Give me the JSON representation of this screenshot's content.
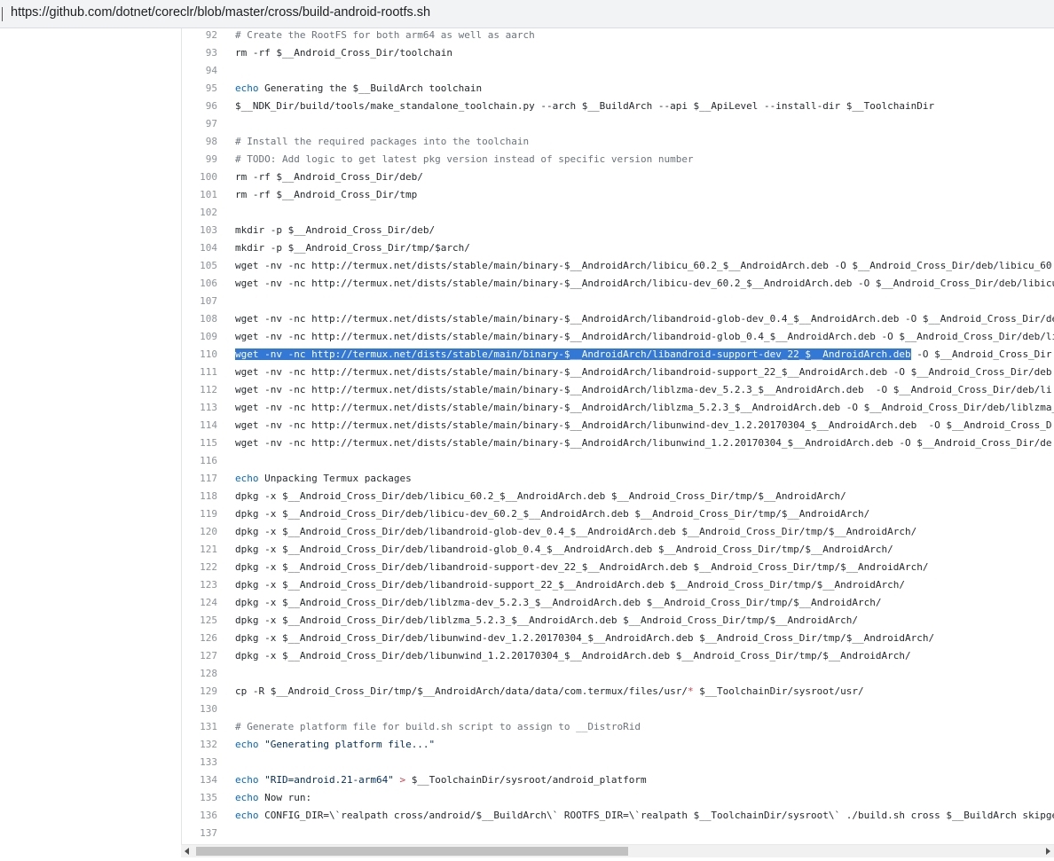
{
  "address_bar": {
    "url": "https://github.com/dotnet/coreclr/blob/master/cross/build-android-rootfs.sh"
  },
  "colors": {
    "keyword": "#0366d6",
    "comment": "#6a737d",
    "selection": "#3478d6"
  },
  "code": {
    "lines": [
      {
        "n": "92",
        "seg": [
          {
            "t": "# Create the RootFS for both arm64 as well as aarch",
            "c": "cm"
          }
        ]
      },
      {
        "n": "93",
        "seg": [
          {
            "t": "rm -rf $__Android_Cross_Dir/toolchain"
          }
        ]
      },
      {
        "n": "94",
        "seg": []
      },
      {
        "n": "95",
        "seg": [
          {
            "t": "echo",
            "c": "kw"
          },
          {
            "t": " Generating the $__BuildArch toolchain"
          }
        ]
      },
      {
        "n": "96",
        "seg": [
          {
            "t": "$__NDK_Dir/build/tools/make_standalone_toolchain.py --arch $__BuildArch --api $__ApiLevel --install-dir $__ToolchainDir"
          }
        ]
      },
      {
        "n": "97",
        "seg": []
      },
      {
        "n": "98",
        "seg": [
          {
            "t": "# Install the required packages into the toolchain",
            "c": "cm"
          }
        ]
      },
      {
        "n": "99",
        "seg": [
          {
            "t": "# TODO: Add logic to get latest pkg version instead of specific version number",
            "c": "cm"
          }
        ]
      },
      {
        "n": "100",
        "seg": [
          {
            "t": "rm -rf $__Android_Cross_Dir/deb/"
          }
        ]
      },
      {
        "n": "101",
        "seg": [
          {
            "t": "rm -rf $__Android_Cross_Dir/tmp"
          }
        ]
      },
      {
        "n": "102",
        "seg": []
      },
      {
        "n": "103",
        "seg": [
          {
            "t": "mkdir -p $__Android_Cross_Dir/deb/"
          }
        ]
      },
      {
        "n": "104",
        "seg": [
          {
            "t": "mkdir -p $__Android_Cross_Dir/tmp/$arch/"
          }
        ]
      },
      {
        "n": "105",
        "seg": [
          {
            "t": "wget -nv -nc http://termux.net/dists/stable/main/binary-$__AndroidArch/libicu_60.2_$__AndroidArch.deb -O $__Android_Cross_Dir/deb/libicu_60"
          }
        ]
      },
      {
        "n": "106",
        "seg": [
          {
            "t": "wget -nv -nc http://termux.net/dists/stable/main/binary-$__AndroidArch/libicu-dev_60.2_$__AndroidArch.deb -O $__Android_Cross_Dir/deb/libicu"
          }
        ]
      },
      {
        "n": "107",
        "seg": []
      },
      {
        "n": "108",
        "seg": [
          {
            "t": "wget -nv -nc http://termux.net/dists/stable/main/binary-$__AndroidArch/libandroid-glob-dev_0.4_$__AndroidArch.deb -O $__Android_Cross_Dir/de"
          }
        ]
      },
      {
        "n": "109",
        "seg": [
          {
            "t": "wget -nv -nc http://termux.net/dists/stable/main/binary-$__AndroidArch/libandroid-glob_0.4_$__AndroidArch.deb -O $__Android_Cross_Dir/deb/li"
          }
        ]
      },
      {
        "n": "110",
        "seg": [
          {
            "t": "wget -nv -nc http://termux.net/dists/stable/main/binary-$__AndroidArch/libandroid-support-dev_22_$__AndroidArch.deb",
            "c": "sel"
          },
          {
            "t": " -O $__Android_Cross_Dir"
          }
        ]
      },
      {
        "n": "111",
        "seg": [
          {
            "t": "wget -nv -nc http://termux.net/dists/stable/main/binary-$__AndroidArch/libandroid-support_22_$__AndroidArch.deb -O $__Android_Cross_Dir/deb"
          }
        ]
      },
      {
        "n": "112",
        "seg": [
          {
            "t": "wget -nv -nc http://termux.net/dists/stable/main/binary-$__AndroidArch/liblzma-dev_5.2.3_$__AndroidArch.deb  -O $__Android_Cross_Dir/deb/li"
          }
        ]
      },
      {
        "n": "113",
        "seg": [
          {
            "t": "wget -nv -nc http://termux.net/dists/stable/main/binary-$__AndroidArch/liblzma_5.2.3_$__AndroidArch.deb -O $__Android_Cross_Dir/deb/liblzma_"
          }
        ]
      },
      {
        "n": "114",
        "seg": [
          {
            "t": "wget -nv -nc http://termux.net/dists/stable/main/binary-$__AndroidArch/libunwind-dev_1.2.20170304_$__AndroidArch.deb  -O $__Android_Cross_D"
          }
        ]
      },
      {
        "n": "115",
        "seg": [
          {
            "t": "wget -nv -nc http://termux.net/dists/stable/main/binary-$__AndroidArch/libunwind_1.2.20170304_$__AndroidArch.deb -O $__Android_Cross_Dir/de"
          }
        ]
      },
      {
        "n": "116",
        "seg": []
      },
      {
        "n": "117",
        "seg": [
          {
            "t": "echo",
            "c": "kw"
          },
          {
            "t": " Unpacking Termux packages"
          }
        ]
      },
      {
        "n": "118",
        "seg": [
          {
            "t": "dpkg -x $__Android_Cross_Dir/deb/libicu_60.2_$__AndroidArch.deb $__Android_Cross_Dir/tmp/$__AndroidArch/"
          }
        ]
      },
      {
        "n": "119",
        "seg": [
          {
            "t": "dpkg -x $__Android_Cross_Dir/deb/libicu-dev_60.2_$__AndroidArch.deb $__Android_Cross_Dir/tmp/$__AndroidArch/"
          }
        ]
      },
      {
        "n": "120",
        "seg": [
          {
            "t": "dpkg -x $__Android_Cross_Dir/deb/libandroid-glob-dev_0.4_$__AndroidArch.deb $__Android_Cross_Dir/tmp/$__AndroidArch/"
          }
        ]
      },
      {
        "n": "121",
        "seg": [
          {
            "t": "dpkg -x $__Android_Cross_Dir/deb/libandroid-glob_0.4_$__AndroidArch.deb $__Android_Cross_Dir/tmp/$__AndroidArch/"
          }
        ]
      },
      {
        "n": "122",
        "seg": [
          {
            "t": "dpkg -x $__Android_Cross_Dir/deb/libandroid-support-dev_22_$__AndroidArch.deb $__Android_Cross_Dir/tmp/$__AndroidArch/"
          }
        ]
      },
      {
        "n": "123",
        "seg": [
          {
            "t": "dpkg -x $__Android_Cross_Dir/deb/libandroid-support_22_$__AndroidArch.deb $__Android_Cross_Dir/tmp/$__AndroidArch/"
          }
        ]
      },
      {
        "n": "124",
        "seg": [
          {
            "t": "dpkg -x $__Android_Cross_Dir/deb/liblzma-dev_5.2.3_$__AndroidArch.deb $__Android_Cross_Dir/tmp/$__AndroidArch/"
          }
        ]
      },
      {
        "n": "125",
        "seg": [
          {
            "t": "dpkg -x $__Android_Cross_Dir/deb/liblzma_5.2.3_$__AndroidArch.deb $__Android_Cross_Dir/tmp/$__AndroidArch/"
          }
        ]
      },
      {
        "n": "126",
        "seg": [
          {
            "t": "dpkg -x $__Android_Cross_Dir/deb/libunwind-dev_1.2.20170304_$__AndroidArch.deb $__Android_Cross_Dir/tmp/$__AndroidArch/"
          }
        ]
      },
      {
        "n": "127",
        "seg": [
          {
            "t": "dpkg -x $__Android_Cross_Dir/deb/libunwind_1.2.20170304_$__AndroidArch.deb $__Android_Cross_Dir/tmp/$__AndroidArch/"
          }
        ]
      },
      {
        "n": "128",
        "seg": []
      },
      {
        "n": "129",
        "seg": [
          {
            "t": "cp -R $__Android_Cross_Dir/tmp/$__AndroidArch/data/data/com.termux/files/usr/"
          },
          {
            "t": "*",
            "c": "op"
          },
          {
            "t": " $__ToolchainDir/sysroot/usr/"
          }
        ]
      },
      {
        "n": "130",
        "seg": []
      },
      {
        "n": "131",
        "seg": [
          {
            "t": "# Generate platform file for build.sh script to assign to __DistroRid",
            "c": "cm"
          }
        ]
      },
      {
        "n": "132",
        "seg": [
          {
            "t": "echo",
            "c": "kw"
          },
          {
            "t": " "
          },
          {
            "t": "\"Generating platform file...\"",
            "c": "st"
          }
        ]
      },
      {
        "n": "133",
        "seg": []
      },
      {
        "n": "134",
        "seg": [
          {
            "t": "echo",
            "c": "kw"
          },
          {
            "t": " "
          },
          {
            "t": "\"RID=android.21-arm64\"",
            "c": "st"
          },
          {
            "t": " "
          },
          {
            "t": ">",
            "c": "op"
          },
          {
            "t": " $__ToolchainDir/sysroot/android_platform"
          }
        ]
      },
      {
        "n": "135",
        "seg": [
          {
            "t": "echo",
            "c": "kw"
          },
          {
            "t": " Now run:"
          }
        ]
      },
      {
        "n": "136",
        "seg": [
          {
            "t": "echo",
            "c": "kw"
          },
          {
            "t": " CONFIG_DIR=\\`realpath cross/android/$__BuildArch\\` ROOTFS_DIR=\\`realpath $__ToolchainDir/sysroot\\` ./build.sh cross $__BuildArch skipge"
          }
        ]
      },
      {
        "n": "137",
        "seg": []
      }
    ]
  }
}
